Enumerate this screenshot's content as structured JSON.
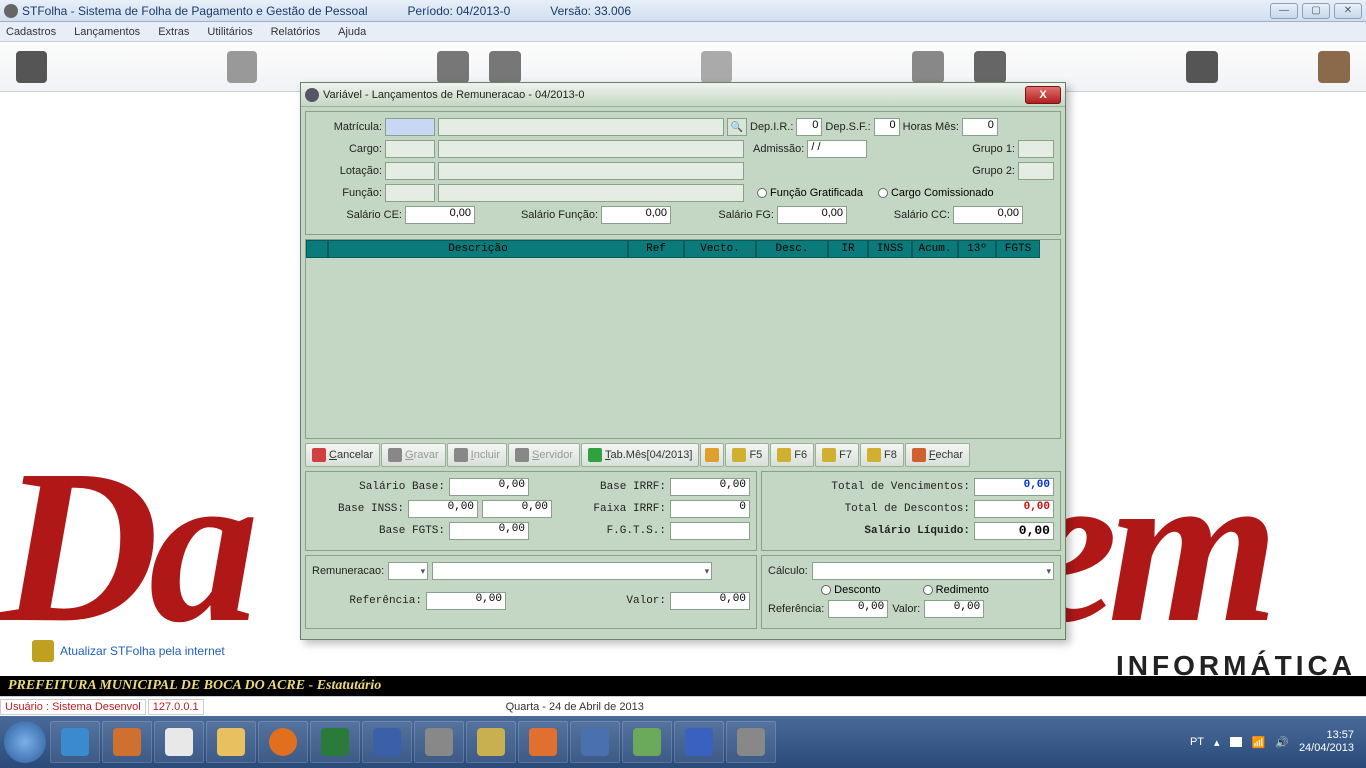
{
  "title": {
    "app": "STFolha - Sistema de Folha de Pagamento e Gestão de Pessoal",
    "periodo": "Período: 04/2013-0",
    "versao": "Versão: 33.006"
  },
  "menu": {
    "m1": "Cadastros",
    "m2": "Lançamentos",
    "m3": "Extras",
    "m4": "Utilitários",
    "m5": "Relatórios",
    "m6": "Ajuda"
  },
  "bg": {
    "link": "Atualizar STFolha pela internet",
    "info": "INFORMÁTICA"
  },
  "banner": "PREFEITURA MUNICIPAL DE BOCA DO ACRE - Estatutário",
  "status": {
    "user": "Usuário : Sistema Desenvol",
    "ip": "127.0.0.1",
    "date": "Quarta - 24 de Abril de 2013"
  },
  "tray": {
    "lang": "PT",
    "time": "13:57",
    "tdate": "24/04/2013"
  },
  "modal": {
    "title": "Variável - Lançamentos de Remuneracao - 04/2013-0",
    "f": {
      "matricula_l": "Matrícula:",
      "cargo_l": "Cargo:",
      "lotacao_l": "Lotação:",
      "funcao_l": "Função:",
      "depir_l": "Dep.I.R.:",
      "depir_v": "0",
      "depsf_l": "Dep.S.F.:",
      "depsf_v": "0",
      "horas_l": "Horas Mês:",
      "horas_v": "0",
      "admissao_l": "Admissão:",
      "admissao_v": "/ /",
      "grupo1_l": "Grupo 1:",
      "grupo2_l": "Grupo 2:",
      "radio_fg": "Função Gratificada",
      "radio_cc": "Cargo Comissionado",
      "salce_l": "Salário CE:",
      "salce_v": "0,00",
      "salfn_l": "Salário Função:",
      "salfn_v": "0,00",
      "salfg_l": "Salário FG:",
      "salfg_v": "0,00",
      "salcc_l": "Salário CC:",
      "salcc_v": "0,00"
    },
    "cols": {
      "c1": "Descrição",
      "c2": "Ref",
      "c3": "Vecto.",
      "c4": "Desc.",
      "c5": "IR",
      "c6": "INSS",
      "c7": "Acum.",
      "c8": "13º",
      "c9": "FGTS"
    },
    "buttons": {
      "cancel": "Cancelar",
      "gravar": "Gravar",
      "incluir": "Incluir",
      "servidor": "Servidor",
      "tabmes": "Tab.Mês[04/2013]",
      "f5": "F5",
      "f6": "F6",
      "f7": "F7",
      "f8": "F8",
      "fechar": "Fechar"
    },
    "tot": {
      "salbase_l": "Salário Base:",
      "salbase_v": "0,00",
      "baseinss_l": "Base INSS:",
      "baseinss_v1": "0,00",
      "baseinss_v2": "0,00",
      "basefgts_l": "Base FGTS:",
      "basefgts_v": "0,00",
      "baseirrf_l": "Base IRRF:",
      "baseirrf_v": "0,00",
      "faixairrf_l": "Faixa IRRF:",
      "faixairrf_v": "0",
      "fgts_l": "F.G.T.S.:",
      "venc_l": "Total de Vencimentos:",
      "venc_v": "0,00",
      "desc_l": "Total de Descontos:",
      "desc_v": "0,00",
      "liq_l": "Salário Líquido:",
      "liq_v": "0,00"
    },
    "bottom": {
      "remun_l": "Remuneracao:",
      "ref_l": "Referência:",
      "ref_v": "0,00",
      "valor_l": "Valor:",
      "valor_v": "0,00",
      "calc_l": "Cálculo:",
      "desconto": "Desconto",
      "redimento": "Redimento",
      "ref2_l": "Referência:",
      "ref2_v": "0,00",
      "valor2_l": "Valor:",
      "valor2_v": "0,00"
    }
  }
}
